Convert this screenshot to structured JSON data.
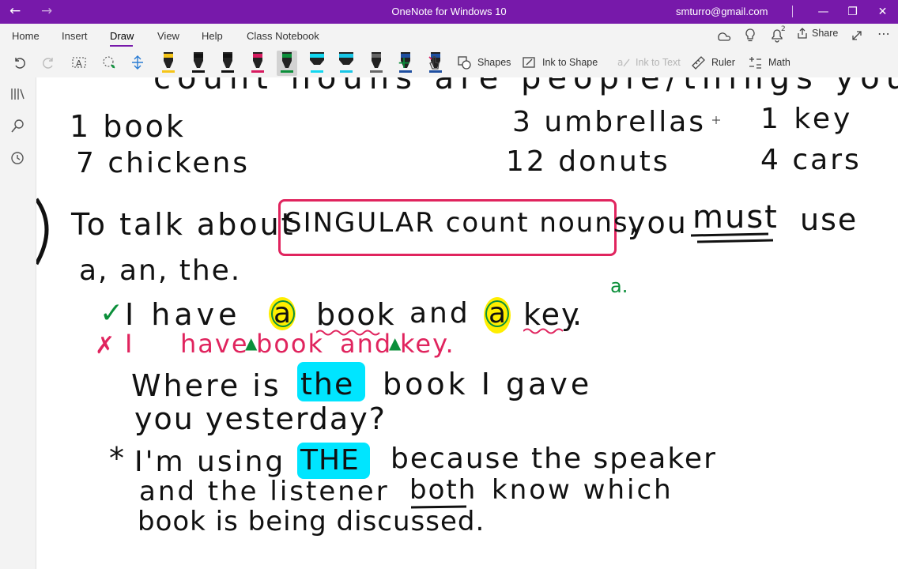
{
  "titlebar": {
    "title": "OneNote for Windows 10",
    "user": "smturro@gmail.com",
    "back_glyph": "←",
    "forward_glyph": "→",
    "minimize_glyph": "—",
    "maximize_glyph": "❐",
    "close_glyph": "✕"
  },
  "ribbon": {
    "tabs": [
      "Home",
      "Insert",
      "Draw",
      "View",
      "Help",
      "Class Notebook"
    ],
    "active_tab": "Draw",
    "share_label": "Share",
    "more_glyph": "⋯",
    "notification_count": "2"
  },
  "toolbar": {
    "shapes_label": "Shapes",
    "ink_to_shape_label": "Ink to Shape",
    "ink_to_text_label": "Ink to Text",
    "ruler_label": "Ruler",
    "math_label": "Math",
    "add_pen_glyph": "+"
  },
  "pens": [
    {
      "color": "#f5c518",
      "icon": "pen-icon"
    },
    {
      "color": "#111111",
      "icon": "pen-icon"
    },
    {
      "color": "#111111",
      "icon": "pen-icon"
    },
    {
      "color": "#d81b60",
      "icon": "pen-icon"
    },
    {
      "color": "#0b8f3a",
      "icon": "pen-icon",
      "selected": true
    },
    {
      "color": "#13d7f0",
      "icon": "highlighter-icon"
    },
    {
      "color": "#19c6e6",
      "icon": "highlighter-icon"
    },
    {
      "color": "#666666",
      "icon": "pencil-icon"
    },
    {
      "color": "#1f4fa0",
      "icon": "pen-icon"
    },
    {
      "color": "#1f4fa0",
      "icon": "pen-icon"
    }
  ],
  "colors": {
    "accent": "#7719aa",
    "ink_black": "#111111",
    "ink_pink": "#e0245e",
    "ink_green": "#0b8f3a",
    "highlight_yellow": "#ffee00",
    "highlight_cyan": "#00e5ff"
  },
  "note": {
    "header_partial": "count nouns are people/things you can count.",
    "examples": [
      {
        "text": "1 book"
      },
      {
        "text": "7 chickens"
      },
      {
        "text": "3 umbrellas"
      },
      {
        "text": "12 donuts"
      },
      {
        "text": "1 key"
      },
      {
        "text": "4 cars"
      }
    ],
    "rule_prefix": "To talk about",
    "rule_boxed": "SINGULAR count nouns,",
    "rule_suffix_1": "you",
    "rule_must": "must",
    "rule_suffix_2": "use",
    "rule_line2": "a, an, the.",
    "correct_mark": "✓",
    "correct_parts": [
      "I have",
      "a",
      "book",
      "and",
      "a",
      "key",
      "."
    ],
    "wrong_mark": "✗",
    "wrong_text_1": "I",
    "wrong_text_2": "have",
    "wrong_book": "book",
    "wrong_and": "and",
    "wrong_key": "key.",
    "green_note": "a.",
    "q_line1_a": "Where is",
    "q_the": "the",
    "q_line1_b": "book I gave",
    "q_line2": "you yesterday?",
    "star": "*",
    "exp_line1_a": "I'm using",
    "exp_the": "THE",
    "exp_line1_b": "because the speaker",
    "exp_line2_a": "and the listener",
    "exp_both": "both",
    "exp_line2_b": "know which",
    "exp_line3": "book is being discussed."
  }
}
